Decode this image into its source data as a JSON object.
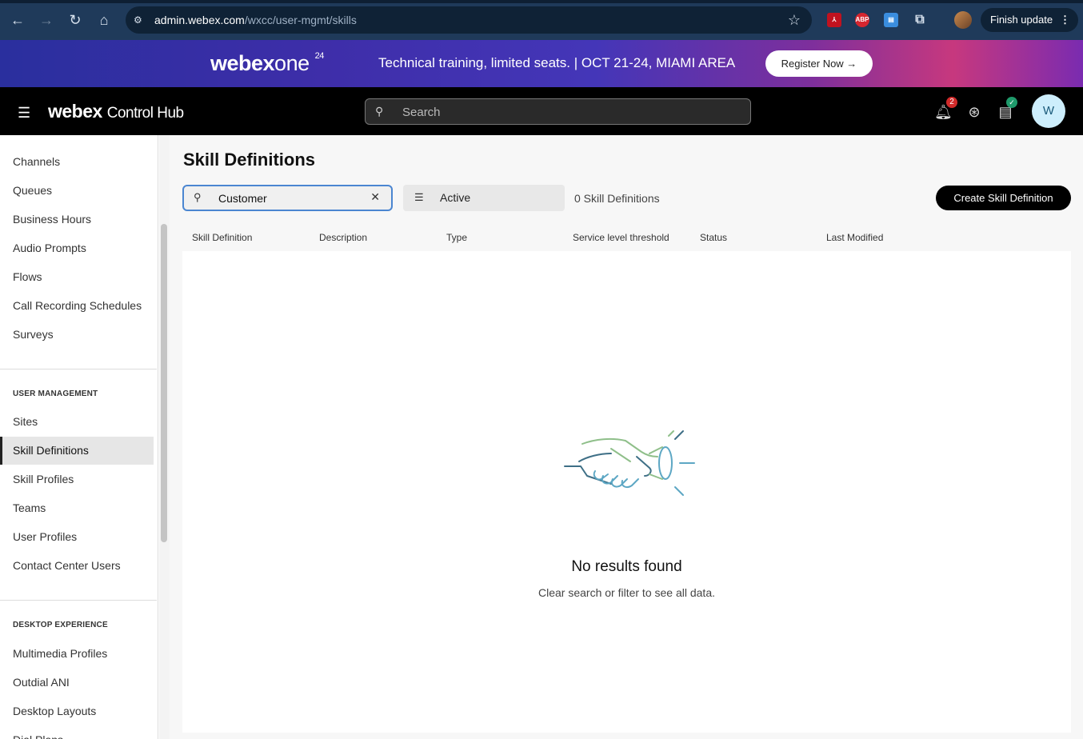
{
  "browser": {
    "url_domain": "admin.webex.com",
    "url_path": "/wxcc/user-mgmt/skills",
    "finish_update_label": "Finish update",
    "extensions": [
      "pdf-extension-icon",
      "abp-extension-icon",
      "reader-extension-icon",
      "puzzle-icon"
    ],
    "abp_label": "ABP"
  },
  "banner": {
    "logo_main": "webex",
    "logo_one": "one",
    "logo_sup": "24",
    "text": "Technical training, limited seats. | OCT 21-24, MIAMI AREA",
    "cta": "Register Now →"
  },
  "header": {
    "brand": "webex",
    "product": "Control Hub",
    "search_placeholder": "Search",
    "notifications_count": "2",
    "avatar_initial": "W"
  },
  "sidebar": {
    "items_top": [
      {
        "label": "Channels"
      },
      {
        "label": "Queues"
      },
      {
        "label": "Business Hours"
      },
      {
        "label": "Audio Prompts"
      },
      {
        "label": "Flows"
      },
      {
        "label": "Call Recording Schedules"
      },
      {
        "label": "Surveys"
      }
    ],
    "user_management_header": "USER MANAGEMENT",
    "user_management_items": [
      {
        "label": "Sites"
      },
      {
        "label": "Skill Definitions"
      },
      {
        "label": "Skill Profiles"
      },
      {
        "label": "Teams"
      },
      {
        "label": "User Profiles"
      },
      {
        "label": "Contact Center Users"
      }
    ],
    "desktop_header": "DESKTOP EXPERIENCE",
    "desktop_items": [
      {
        "label": "Multimedia Profiles"
      },
      {
        "label": "Outdial ANI"
      },
      {
        "label": "Desktop Layouts"
      },
      {
        "label": "Dial Plans"
      }
    ]
  },
  "main": {
    "title": "Skill Definitions",
    "search_value": "Customer",
    "filter_value": "Active",
    "count_text": "0 Skill Definitions",
    "create_label": "Create Skill Definition",
    "columns": [
      "Skill Definition",
      "Description",
      "Type",
      "Service level threshold",
      "Status",
      "Last Modified"
    ],
    "empty_title": "No results found",
    "empty_subtitle": "Clear search or filter to see all data."
  }
}
